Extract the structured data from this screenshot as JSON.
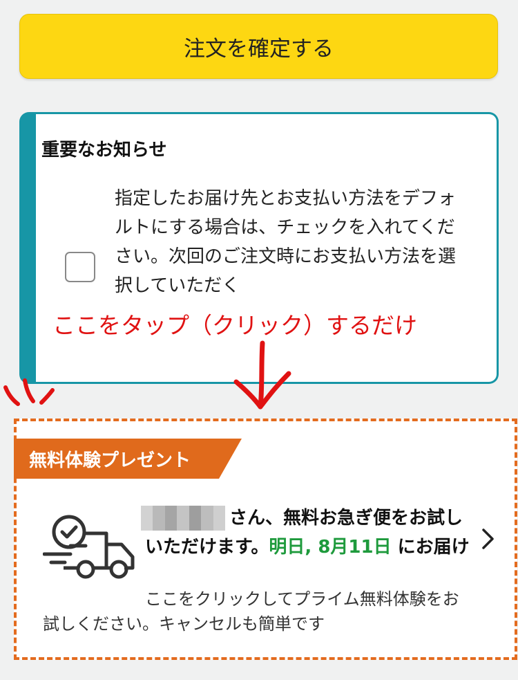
{
  "confirm_button": {
    "label": "注文を確定する"
  },
  "notice": {
    "title": "重要なお知らせ",
    "body": "指定したお届け先とお支払い方法をデフォルトにする場合は、チェックを入れてください。次回のご注文時にお支払い方法を選択していただく",
    "checked": false
  },
  "annotation": {
    "text": "ここをタップ（クリック）するだけ",
    "color": "#e01212"
  },
  "promo": {
    "label": "無料体験プレゼント",
    "headline_part1": "さん、無料お急ぎ便をお試しいただけます。",
    "delivery_date": "明日, 8月11日",
    "headline_part2": " にお届け",
    "subtext": "ここをクリックしてプライム無料体験をお試しください。キャンセルも簡単です",
    "accent_color": "#e06a1c",
    "date_color": "#1e9a3c",
    "icon": "delivery-truck-icon"
  },
  "colors": {
    "button": "#fdd712",
    "notice_border": "#1796a6",
    "background": "#f0f1f1"
  }
}
